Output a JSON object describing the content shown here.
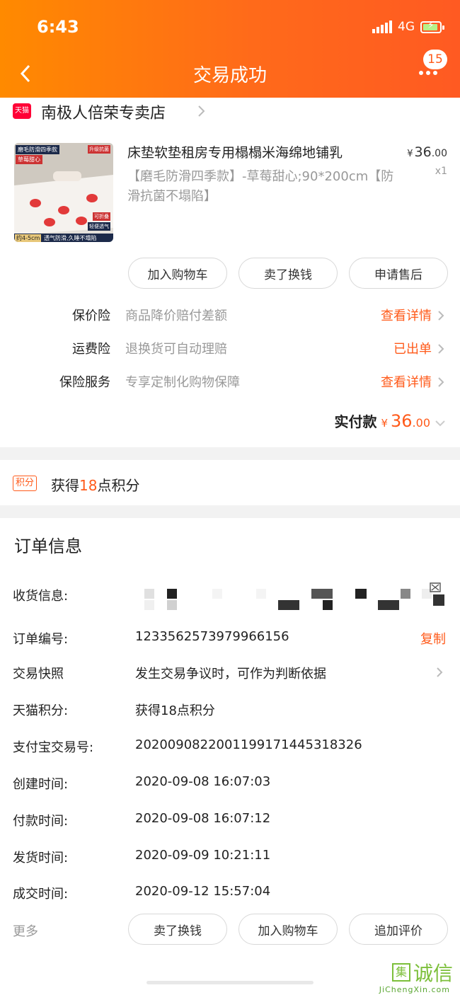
{
  "status_bar": {
    "time": "6:43",
    "network": "4G"
  },
  "header": {
    "title": "交易成功",
    "badge_count": "15"
  },
  "shop": {
    "platform_badge": "天猫",
    "name": "南极人倍荣专卖店"
  },
  "product": {
    "image_texts": {
      "tag1": "磨毛防滑四季款",
      "tag2": "草莓甜心",
      "tag3": "升级抗菌",
      "tag4": "可折叠",
      "tag5": "轻便透气",
      "thickness": "约4-5cm",
      "slogan": "透气防滑,久睡不塌陷"
    },
    "title": "床垫软垫租房专用榻榻米海绵地铺乳",
    "sku": "【磨毛防滑四季款】-草莓甜心;90*200cm【防滑抗菌不塌陷】",
    "price_currency": "¥",
    "price_int": "36",
    "price_dec": ".00",
    "quantity": "x1"
  },
  "actions": {
    "add_cart": "加入购物车",
    "resell": "卖了换钱",
    "after_sale": "申请售后"
  },
  "services": [
    {
      "label": "保价险",
      "desc": "商品降价赔付差额",
      "action": "查看详情"
    },
    {
      "label": "运费险",
      "desc": "退换货可自动理赔",
      "action": "已出单"
    },
    {
      "label": "保险服务",
      "desc": "专享定制化购物保障",
      "action": "查看详情"
    }
  ],
  "paid": {
    "label": "实付款",
    "currency": "¥",
    "int": "36",
    "dec": ".00"
  },
  "points": {
    "tag": "积分",
    "prefix": "获得",
    "value": "18",
    "suffix": "点积分"
  },
  "order_info": {
    "title": "订单信息",
    "rows": [
      {
        "label": "收货信息:",
        "value": ""
      },
      {
        "label": "订单编号:",
        "value": "1233562573979966156",
        "action": "复制"
      },
      {
        "label": "交易快照",
        "value": "发生交易争议时，可作为判断依据"
      },
      {
        "label": "天猫积分:",
        "value": "获得18点积分"
      },
      {
        "label": "支付宝交易号:",
        "value": "2020090822001199171445318326"
      },
      {
        "label": "创建时间:",
        "value": "2020-09-08 16:07:03"
      },
      {
        "label": "付款时间:",
        "value": "2020-09-08 16:07:12"
      },
      {
        "label": "发货时间:",
        "value": "2020-09-09 10:21:11"
      },
      {
        "label": "成交时间:",
        "value": "2020-09-12 15:57:04"
      }
    ]
  },
  "bottom_bar": {
    "more": "更多",
    "resell": "卖了换钱",
    "add_cart": "加入购物车",
    "review": "追加评价"
  },
  "watermark": {
    "mark": "集",
    "text": "诚信",
    "url": "JiChengXin.com"
  },
  "colors": {
    "accent": "#ff5a1a",
    "header_start": "#ff8a00",
    "header_end": "#ff5a22",
    "tmall_red": "#ff0036"
  }
}
